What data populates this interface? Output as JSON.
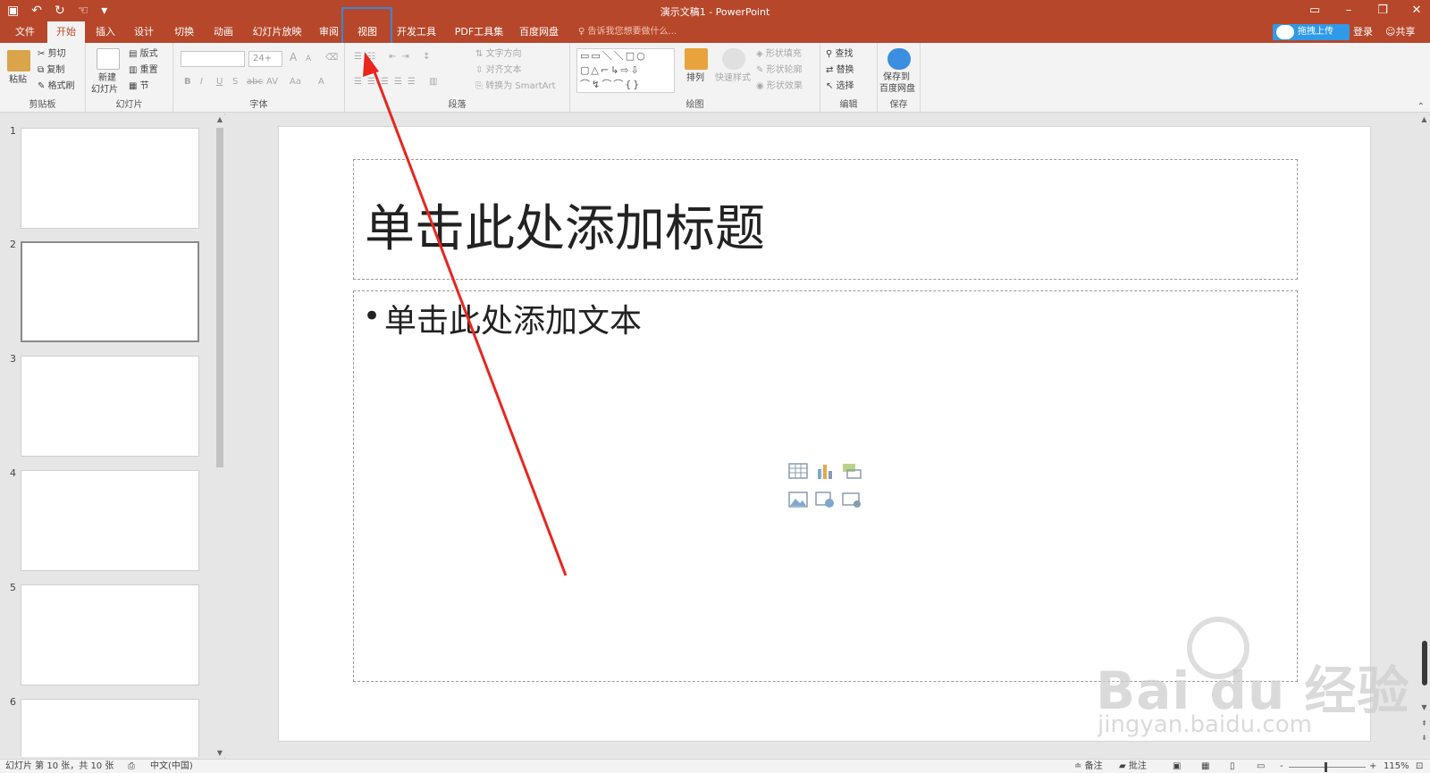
{
  "window": {
    "title": "演示文稿1 - PowerPoint",
    "qat_icons": [
      "save-icon",
      "undo-icon",
      "redo-icon",
      "touch-mode-icon",
      "customize-qat-icon"
    ],
    "controls": [
      "ribbon-display-icon",
      "minimize-icon",
      "restore-icon",
      "close-icon"
    ]
  },
  "tabs": [
    "文件",
    "开始",
    "插入",
    "设计",
    "切换",
    "动画",
    "幻灯片放映",
    "审阅",
    "视图",
    "开发工具",
    "PDF工具集",
    "百度网盘"
  ],
  "active_tab": "开始",
  "tell_me": "告诉我您想要做什么...",
  "account": {
    "upload": "拖拽上传",
    "login": "登录",
    "share": "共享"
  },
  "ribbon": {
    "clipboard": {
      "label": "剪贴板",
      "paste": "粘贴",
      "cut": "剪切",
      "copy": "复制",
      "format_painter": "格式刷"
    },
    "slides": {
      "label": "幻灯片",
      "new_slide_1": "新建",
      "new_slide_2": "幻灯片",
      "layout": "版式",
      "reset": "重置",
      "section": "节"
    },
    "font": {
      "label": "字体",
      "font_name": "",
      "font_size": "24+",
      "bold": "B",
      "italic": "I",
      "underline": "U",
      "strike": "S",
      "shadow": "abc",
      "spacing": "AV",
      "case": "Aa",
      "color": "A",
      "grow": "A",
      "shrink": "A"
    },
    "paragraph": {
      "label": "段落",
      "text_direction": "文字方向",
      "align_text": "对齐文本",
      "smartart": "转换为 SmartArt"
    },
    "drawing": {
      "label": "绘图",
      "arrange": "排列",
      "quick_styles": "快速样式",
      "shape_fill": "形状填充",
      "shape_outline": "形状轮廓",
      "shape_effects": "形状效果"
    },
    "editing": {
      "label": "编辑",
      "find": "查找",
      "replace": "替换",
      "select": "选择"
    },
    "save": {
      "label": "保存",
      "save_to_1": "保存到",
      "save_to_2": "百度网盘"
    }
  },
  "thumbnails": [
    {
      "num": "1",
      "selected": false
    },
    {
      "num": "2",
      "selected": true
    },
    {
      "num": "3",
      "selected": false
    },
    {
      "num": "4",
      "selected": false
    },
    {
      "num": "5",
      "selected": false
    },
    {
      "num": "6",
      "selected": false
    }
  ],
  "slide": {
    "title_placeholder": "单击此处添加标题",
    "body_placeholder": "单击此处添加文本",
    "bullet": "•",
    "insert_icons": [
      "insert-table-icon",
      "insert-chart-icon",
      "insert-smartart-icon",
      "insert-picture-icon",
      "insert-online-picture-icon",
      "insert-video-icon"
    ]
  },
  "watermark": {
    "main": "Bai du 经验",
    "sub": "jingyan.baidu.com"
  },
  "status": {
    "slide_info": "幻灯片 第 10 张，共 10 张",
    "language": "中文(中国)",
    "notes": "备注",
    "comments": "批注",
    "zoom": "115%",
    "zoom_out": "-",
    "zoom_in": "+"
  },
  "colors": {
    "accent": "#b7472a",
    "highlight_box": "#3a86d4",
    "annotation_arrow": "#e8261f"
  }
}
